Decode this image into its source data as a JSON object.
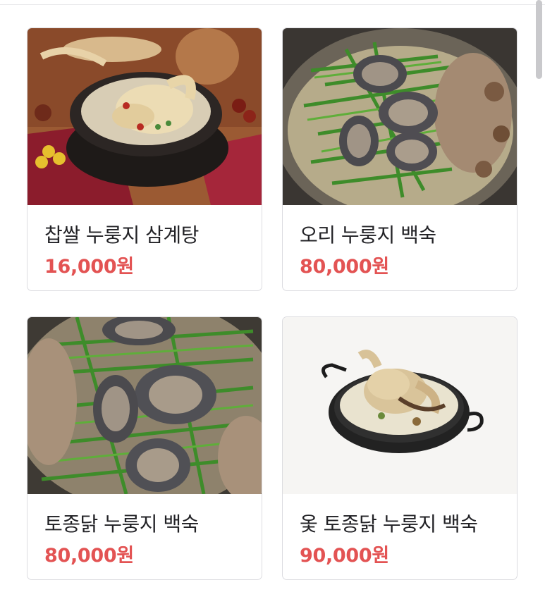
{
  "products": [
    {
      "name": "찹쌀 누룽지 삼계탕",
      "price": "16,000원",
      "image_icon": "samgyetang-photo"
    },
    {
      "name": "오리 누룽지 백숙",
      "price": "80,000원",
      "image_icon": "duck-baeksuk-photo"
    },
    {
      "name": "토종닭 누룽지 백숙",
      "price": "80,000원",
      "image_icon": "chicken-baeksuk-photo"
    },
    {
      "name": "옻 토종닭 누룽지 백숙",
      "price": "90,000원",
      "image_icon": "ot-chicken-baeksuk-photo"
    }
  ]
}
